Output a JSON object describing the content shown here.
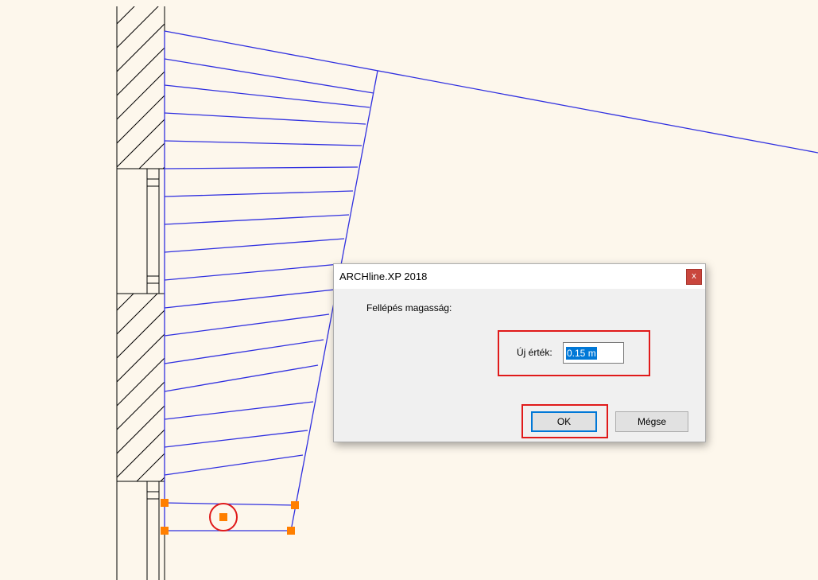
{
  "dialog": {
    "title": "ARCHline.XP 2018",
    "close_glyph": "x",
    "prompt": "Fellépés magasság:",
    "value_label": "Új érték:",
    "value": "0.15 m",
    "ok_label": "OK",
    "cancel_label": "Mégse"
  },
  "colors": {
    "canvas_bg": "#fdf7ec",
    "stair_lines": "#3030e0",
    "highlight": "#e01a1a",
    "grip": "#ff7f00",
    "selection": "#0078d7"
  },
  "icons": {
    "close": "close-icon"
  }
}
